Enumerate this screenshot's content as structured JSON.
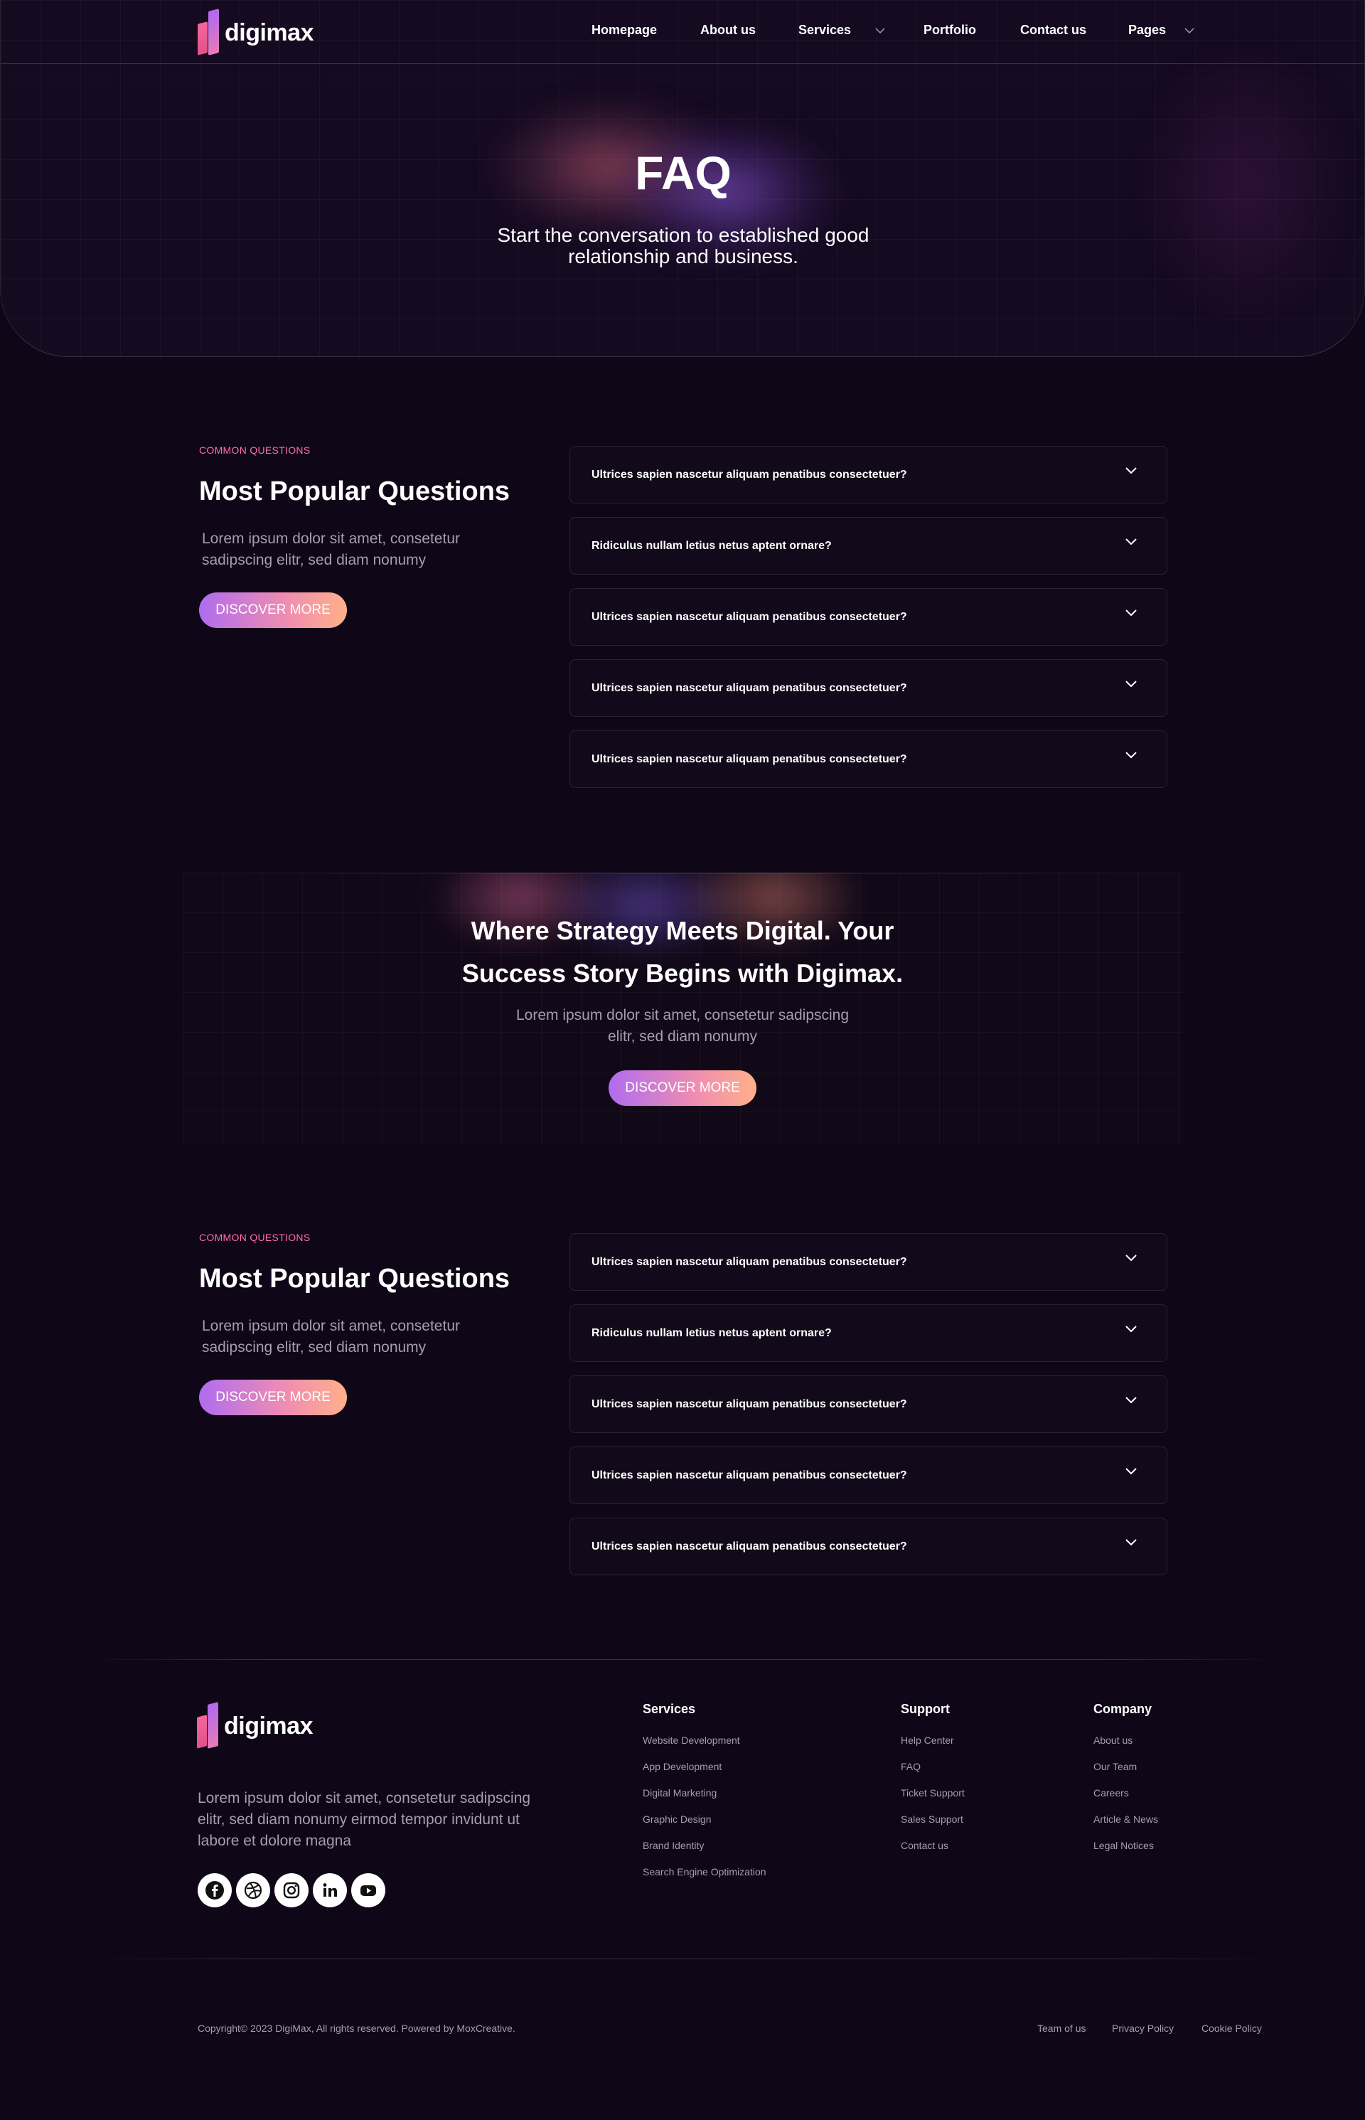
{
  "brand": {
    "name": "digimax"
  },
  "nav": {
    "items": [
      {
        "label": "Homepage"
      },
      {
        "label": "About us"
      },
      {
        "label": "Services"
      },
      {
        "label": "Portfolio"
      },
      {
        "label": "Contact us"
      },
      {
        "label": "Pages"
      }
    ]
  },
  "hero": {
    "title": "FAQ",
    "subtitle": "Start the conversation to established good relationship and business."
  },
  "faq_sections": [
    {
      "eyebrow": "COMMON QUESTIONS",
      "title": "Most Popular Questions",
      "description": "Lorem ipsum dolor sit amet, consetetur sadipscing elitr, sed diam nonumy",
      "button": "DISCOVER MORE",
      "questions": [
        "Ultrices sapien nascetur aliquam penatibus consectetuer?",
        "Ridiculus nullam letius netus aptent ornare?",
        "Ultrices sapien nascetur aliquam penatibus consectetuer?",
        "Ultrices sapien nascetur aliquam penatibus consectetuer?",
        "Ultrices sapien nascetur aliquam penatibus consectetuer?"
      ]
    },
    {
      "eyebrow": "COMMON QUESTIONS",
      "title": "Most Popular Questions",
      "description": "Lorem ipsum dolor sit amet, consetetur sadipscing elitr, sed diam nonumy",
      "button": "DISCOVER MORE",
      "questions": [
        "Ultrices sapien nascetur aliquam penatibus consectetuer?",
        "Ridiculus nullam letius netus aptent ornare?",
        "Ultrices sapien nascetur aliquam penatibus consectetuer?",
        "Ultrices sapien nascetur aliquam penatibus consectetuer?",
        "Ultrices sapien nascetur aliquam penatibus consectetuer?"
      ]
    }
  ],
  "cta": {
    "title_line1": "Where Strategy Meets Digital. Your",
    "title_line2": "Success Story Begins with Digimax.",
    "description": "Lorem ipsum dolor sit amet, consetetur sadipscing elitr, sed diam nonumy",
    "button": "DISCOVER MORE"
  },
  "footer": {
    "description": "Lorem ipsum dolor sit amet, consetetur sadipscing elitr, sed diam nonumy eirmod tempor invidunt ut labore et dolore magna",
    "socials": [
      "facebook-icon",
      "dribbble-icon",
      "instagram-icon",
      "linkedin-icon",
      "youtube-icon"
    ],
    "columns": [
      {
        "title": "Services",
        "links": [
          "Website Development",
          "App Development",
          "Digital Marketing",
          "Graphic Design",
          "Brand Identity",
          "Search Engine Optimization"
        ]
      },
      {
        "title": "Support",
        "links": [
          "Help Center",
          "FAQ",
          "Ticket Support",
          "Sales Support",
          "Contact us"
        ]
      },
      {
        "title": "Company",
        "links": [
          "About us",
          "Our Team",
          "Careers",
          "Article & News",
          "Legal Notices"
        ]
      }
    ],
    "copyright": "Copyright© 2023 DigiMax, All rights reserved. Powered by MoxCreative.",
    "legal_links": [
      "Team of us",
      "Privacy Policy",
      "Cookie Policy"
    ]
  },
  "colors": {
    "background": "#0f0717",
    "accent_pink": "#ff6fa8",
    "gradient_start": "#b06cf0",
    "gradient_end": "#ffb08a",
    "muted_text": "#a69dae"
  }
}
